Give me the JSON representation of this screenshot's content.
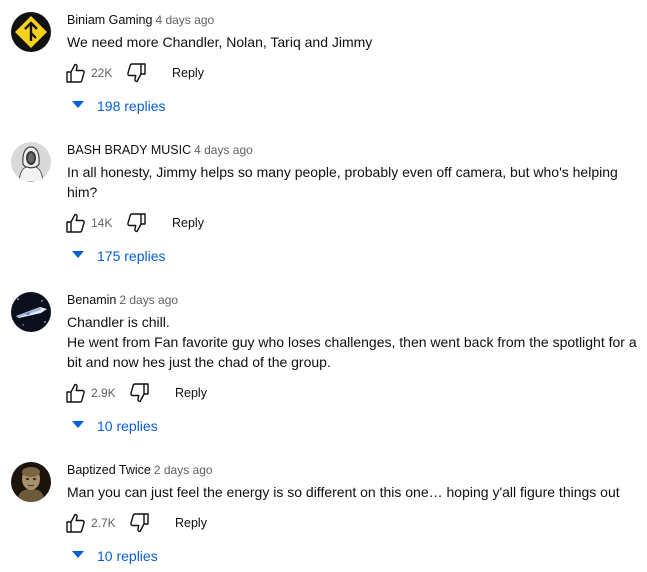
{
  "comments": [
    {
      "author": "Biniam Gaming",
      "time": "4 days ago",
      "lines": [
        "We need more Chandler, Nolan, Tariq and Jimmy"
      ],
      "likes": "22K",
      "reply_label": "Reply",
      "replies_label": "198 replies",
      "avatar_icon": "yellow-diamond-arrow-icon"
    },
    {
      "author": "BASH BRADY MUSIC",
      "time": "4 days ago",
      "lines": [
        "In all honesty, Jimmy helps so many people, probably even off camera, but who's helping",
        "him?"
      ],
      "likes": "14K",
      "reply_label": "Reply",
      "replies_label": "175 replies",
      "avatar_icon": "hooded-figure-avatar"
    },
    {
      "author": "Benamin",
      "time": "2 days ago",
      "lines": [
        "Chandler is chill.",
        "He went from Fan favorite guy who loses challenges, then went back from the spotlight for a",
        "bit and now hes just the chad of the group."
      ],
      "likes": "2.9K",
      "reply_label": "Reply",
      "replies_label": "10 replies",
      "avatar_icon": "spaceship-avatar"
    },
    {
      "author": "Baptized Twice",
      "time": "2 days ago",
      "lines": [
        "Man you can just feel the energy is so different on this one… hoping y'all figure things out"
      ],
      "likes": "2.7K",
      "reply_label": "Reply",
      "replies_label": "10 replies",
      "avatar_icon": "bust-portrait-avatar"
    }
  ],
  "colors": {
    "link_blue": "#065fd4",
    "secondary_text": "#606060",
    "primary_text": "#0f0f0f"
  }
}
